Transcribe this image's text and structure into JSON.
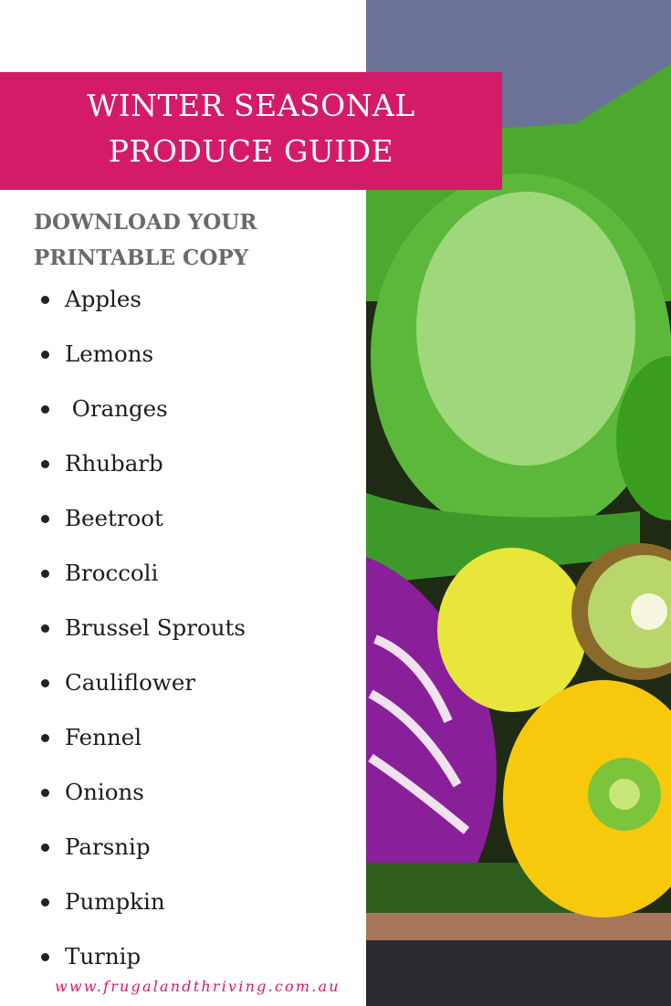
{
  "banner": {
    "line1": "WINTER SEASONAL",
    "line2": "PRODUCE GUIDE",
    "background_color": "#d41b68"
  },
  "subheading": {
    "line1": "DOWNLOAD YOUR",
    "line2": "PRINTABLE COPY"
  },
  "produce_list": [
    "Apples",
    "Lemons",
    " Oranges",
    "Rhubarb",
    "Beetroot",
    "Broccoli",
    "Brussel Sprouts",
    "Cauliflower",
    "Fennel",
    "Onions",
    "Parsnip",
    "Pumpkin",
    "Turnip"
  ],
  "footer": {
    "url": "www.frugalandthriving.com.au"
  },
  "photo": {
    "description": "crate of winter produce: savoy cabbage, red cabbage, lemon, kiwi fruit, yellow capsicum, zucchini, green apple"
  }
}
